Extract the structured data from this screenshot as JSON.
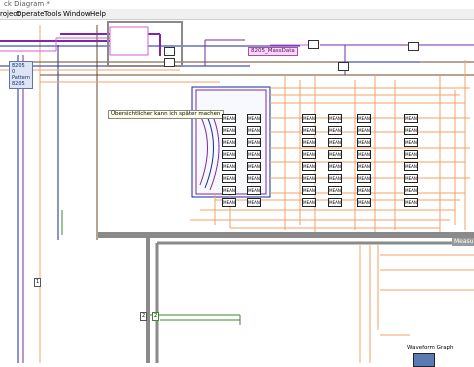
{
  "window": {
    "title": "ck Diagram *"
  },
  "menu": [
    {
      "label": "roject"
    },
    {
      "label": "Operate"
    },
    {
      "label": "Tools"
    },
    {
      "label": "Window"
    },
    {
      "label": "Help"
    }
  ],
  "diagram": {
    "mass_data_label": "8205_MassData",
    "comment": "Übersichtlicher kann ich später machen",
    "cluster_items": [
      "8205",
      "0",
      "Pattern",
      "8205"
    ],
    "measurement_label": "Measurem",
    "waveform_graph_label": "Waveform Graph",
    "mean_label": "MEAN",
    "const_value_a": "2",
    "const_value_b": "2",
    "index_label": "1"
  },
  "colors": {
    "orange_wire": "#f4a06a",
    "blue_wire": "#1a2a9a",
    "purple_wire": "#7a2aa8",
    "pink_wire": "#d55cd5",
    "green_wire": "#3a8a2a",
    "structure_frame": "#8a8a8a"
  }
}
